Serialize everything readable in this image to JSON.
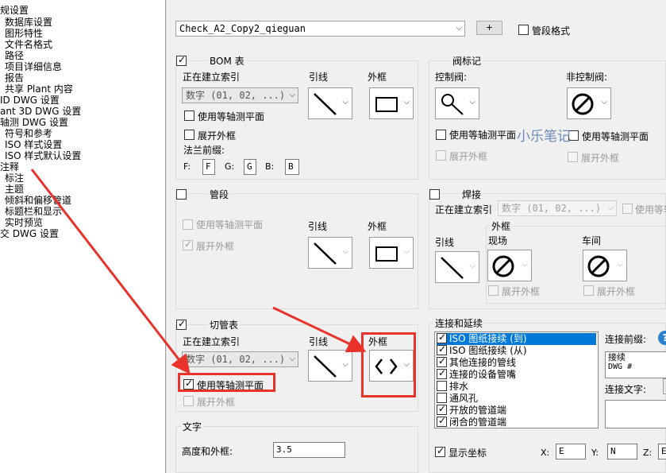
{
  "tree": {
    "items": [
      "规设置",
      "数据库设置",
      "图形特性",
      "文件名格式",
      "路径",
      "项目详细信息",
      "报告",
      "共享 Plant 内容",
      "ID DWG 设置",
      "ant 3D DWG 设置",
      "轴测 DWG 设置",
      "符号和参考",
      "ISO 样式设置",
      "ISO 样式默认设置",
      "注释",
      "标注",
      "主题",
      "倾斜和偏移管道",
      "标题栏和显示",
      "实时预览",
      "交 DWG 设置"
    ]
  },
  "top": {
    "style_combo": "Check_A2_Copy2_qieguan",
    "plus_button": "+",
    "segment_format_label": "管段格式"
  },
  "bom": {
    "title": "BOM 表",
    "index_label": "正在建立索引",
    "index_value": "数字 (01, 02, ...)",
    "use_iso_plane": "使用等轴测平面",
    "expand_frame": "展开外框",
    "leader_label": "引线",
    "frame_label": "外框",
    "flange_label": "法兰前缀:",
    "f_label": "F:",
    "f_value": "F",
    "g_label": "G:",
    "g_value": "G",
    "b_label": "B:",
    "b_value": "B"
  },
  "valve": {
    "title": "阀标记",
    "control_label": "控制阀:",
    "noncontrol_label": "非控制阀:",
    "use_iso_plane_1": "使用等轴测平面",
    "use_iso_plane_2": "使用等轴测平面",
    "expand_frame_1": "展开外框",
    "expand_frame_2": "展开外框"
  },
  "segment": {
    "title": "管段",
    "use_iso_plane": "使用等轴测平面",
    "expand_frame": "展开外框",
    "leader_label": "引线",
    "frame_label": "外框"
  },
  "weld": {
    "title": "焊接",
    "index_label": "正在建立索引",
    "index_value": "数字 (01, 02, ...)",
    "use_iso_plane": "使用等轴",
    "leader_label": "引线",
    "frame_group": "外框",
    "field_label": "现场",
    "shop_label": "车间",
    "expand_frame_1": "展开外框",
    "expand_frame_2": "展开外框"
  },
  "cut": {
    "title": "切管表",
    "index_label": "正在建立索引",
    "index_value": "数字 (01, 02, ...)",
    "use_iso_plane": "使用等轴测平面",
    "expand_frame": "展开外框",
    "leader_label": "引线",
    "frame_label": "外框"
  },
  "connect": {
    "title": "连接和延续",
    "items": [
      {
        "label": "ISO 图纸接续 (到)",
        "checked": true,
        "selected": true
      },
      {
        "label": "ISO 图纸接续 (从)",
        "checked": true,
        "selected": false
      },
      {
        "label": "其他连接的管线",
        "checked": true,
        "selected": false
      },
      {
        "label": "连接的设备管嘴",
        "checked": true,
        "selected": false
      },
      {
        "label": "排水",
        "checked": false,
        "selected": false
      },
      {
        "label": "通风孔",
        "checked": false,
        "selected": false
      },
      {
        "label": "开放的管道端",
        "checked": true,
        "selected": false
      },
      {
        "label": "闭合的管道端",
        "checked": true,
        "selected": false
      }
    ],
    "prefix_label": "连接前缀:",
    "prefix_line1": "接续",
    "prefix_line2": "DWG #",
    "text_label": "连接文字:",
    "show_coords": "显示坐标",
    "x_label": "X:",
    "x_value": "E",
    "y_label": "Y:",
    "y_value": "N",
    "z_label": "Z:",
    "z_value": "E"
  },
  "text": {
    "title": "文字",
    "height_label": "高度和外框:",
    "height_value": "3.5"
  },
  "watermark": "小乐笔记",
  "colors": {
    "highlight_red": "#e8322a",
    "selection_blue": "#0078d7",
    "watermark_blue": "#6d8ab9"
  }
}
